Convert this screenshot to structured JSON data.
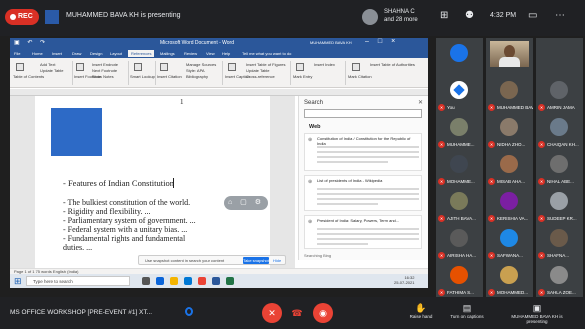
{
  "topbar": {
    "rec_label": "REC",
    "presenting_text": "MUHAMMED BAVA KH is presenting",
    "attendee_name": "SHAHNA C",
    "attendee_more": "and 28 more",
    "clock": "4:32 PM"
  },
  "word": {
    "doc_title": "Microsoft Word Document - Word",
    "user": "MUHAMMED BAVA KH",
    "tabs": [
      "File",
      "Home",
      "Insert",
      "Draw",
      "Design",
      "Layout",
      "References",
      "Mailings",
      "Review",
      "View",
      "Help",
      "Tell me what you want to do"
    ],
    "active_tab": "References",
    "ribbon_items": [
      "Table of Contents",
      "Add Text",
      "Update Table",
      "Insert Footnote",
      "Insert Endnote",
      "Next Footnote",
      "Show Notes",
      "Smart Lookup",
      "Insert Citation",
      "Manage Sources",
      "Style: APA",
      "Bibliography",
      "Insert Caption",
      "Insert Table of Figures",
      "Update Table",
      "Cross-reference",
      "Mark Entry",
      "Insert Index",
      "Mark Citation",
      "Insert Table of Authorities"
    ],
    "page_number": "1",
    "heading": "- Features of Indian Constitution",
    "bullets": [
      "- The bulkiest constitution of the world.",
      "- Rigidity and flexibility. ...",
      "- Parliamentary system of government. ...",
      "- Federal system with a unitary bias. ...",
      "- Fundamental rights and fundamental",
      "  duties. ..."
    ],
    "snap_text": "Use snapshot content in search your content",
    "snap_btn": "Take snapshot",
    "snap_hide": "Hide",
    "status": "Page 1 of 1   75 words   English (India)",
    "search_pane": {
      "title": "Search",
      "web_label": "Web",
      "cards": [
        "Constitution of India / Constitution for the Republic of India",
        "List of presidents of India - Wikipedia",
        "President of India: Salary, Powers, Term and..."
      ],
      "footer": "Searching Bing"
    },
    "taskbar_search": "Type here to search",
    "taskbar_time": "16:32",
    "taskbar_date": "25-07-2021"
  },
  "participants": [
    {
      "name": "",
      "color": "#1a73e8",
      "kind": "avatar-blue"
    },
    {
      "name": "",
      "color": "#c9b79a",
      "kind": "camera"
    },
    {
      "name": "",
      "color": "#3c4043",
      "kind": "empty"
    },
    {
      "name": "You",
      "color": "#1a73e8",
      "kind": "logo"
    },
    {
      "name": "MUHAMMED BAVA KH",
      "color": "#7a6650",
      "kind": "photo"
    },
    {
      "name": "AMRIN JAMA",
      "color": "#5f6368",
      "kind": "photo"
    },
    {
      "name": "MUHAMME...",
      "color": "#7a7f6a",
      "kind": "photo"
    },
    {
      "name": "NIDHA ZHO...",
      "color": "#8a7a6a",
      "kind": "photo"
    },
    {
      "name": "CHAIQAN KH...",
      "color": "#6a7a8a",
      "kind": "photo"
    },
    {
      "name": "MOHAMME...",
      "color": "#3f4650",
      "kind": "photo"
    },
    {
      "name": "MISAB AHA...",
      "color": "#9a6a4a",
      "kind": "photo"
    },
    {
      "name": "NIHAL ABE...",
      "color": "#6e6e6e",
      "kind": "photo"
    },
    {
      "name": "AJITH BAVA...",
      "color": "#7a7a5a",
      "kind": "photo"
    },
    {
      "name": "KERISHIA VA...",
      "color": "#7b1fa2",
      "kind": "letter"
    },
    {
      "name": "SUDEEP KR...",
      "color": "#9aa0a6",
      "kind": "photo"
    },
    {
      "name": "AIRISHA HA...",
      "color": "#5a5a5a",
      "kind": "photo"
    },
    {
      "name": "SAFWANA...",
      "color": "#1e88e5",
      "kind": "letter"
    },
    {
      "name": "SHAFNA...",
      "color": "#6a5a4a",
      "kind": "photo"
    },
    {
      "name": "FATHIMA S...",
      "color": "#e65100",
      "kind": "letter"
    },
    {
      "name": "MOHAMMED...",
      "color": "#c9a050",
      "kind": "photo"
    },
    {
      "name": "SAHLA ZOE...",
      "color": "#8a8a8a",
      "kind": "photo"
    }
  ],
  "bottombar": {
    "meeting_title": "MS OFFICE WORKSHOP [PRE-EVENT #1] XT...",
    "raise_hand": "Raise hand",
    "turn_on_captions": "Turn on captions",
    "presenting_now": "MUHAMMED BAVA KH is presenting"
  }
}
